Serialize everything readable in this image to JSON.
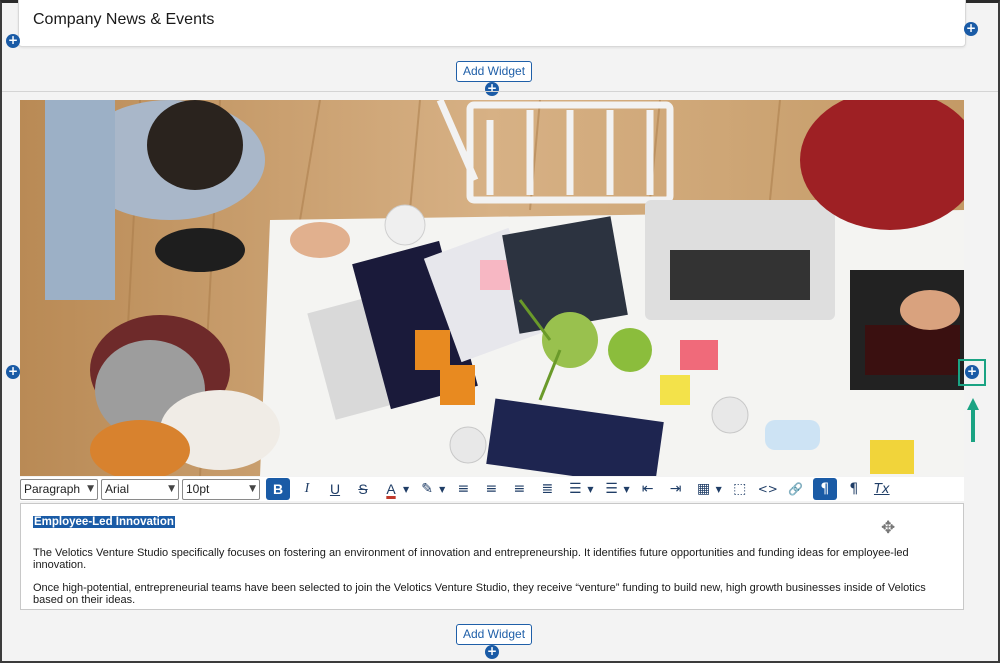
{
  "page": {
    "news_title": "Company News & Events",
    "add_widget_label": "Add Widget",
    "plus_glyph": "+"
  },
  "toolbar": {
    "block_format": "Paragraph",
    "font_family": "Arial",
    "font_size": "10pt",
    "buttons": [
      {
        "name": "bold-button",
        "glyph": "B",
        "active": true
      },
      {
        "name": "italic-button",
        "glyph": "I"
      },
      {
        "name": "underline-button",
        "glyph": "U"
      },
      {
        "name": "strikethrough-button",
        "glyph": "S"
      },
      {
        "name": "text-color-button",
        "glyph": "A"
      },
      {
        "name": "highlight-color-button",
        "glyph": "✎"
      },
      {
        "name": "align-left-button",
        "glyph": "≡"
      },
      {
        "name": "align-center-button",
        "glyph": "≡"
      },
      {
        "name": "align-right-button",
        "glyph": "≡"
      },
      {
        "name": "align-justify-button",
        "glyph": "≣"
      },
      {
        "name": "bullet-list-button",
        "glyph": "☰"
      },
      {
        "name": "numbered-list-button",
        "glyph": "☰"
      },
      {
        "name": "outdent-button",
        "glyph": "⇤"
      },
      {
        "name": "indent-button",
        "glyph": "⇥"
      },
      {
        "name": "table-button",
        "glyph": "▦"
      },
      {
        "name": "select-all-button",
        "glyph": "⬚"
      },
      {
        "name": "source-code-button",
        "glyph": "<>"
      },
      {
        "name": "link-button",
        "glyph": "🔗"
      },
      {
        "name": "ltr-button",
        "glyph": "¶"
      },
      {
        "name": "rtl-button",
        "glyph": "¶"
      },
      {
        "name": "clear-format-button",
        "glyph": "Tx"
      }
    ]
  },
  "editor": {
    "heading": "Employee-Led Innovation",
    "paragraph_1": "The Velotics Venture Studio specifically focuses on fostering an environment of innovation and entrepreneurship. It identifies future opportunities and funding ideas for employee-led innovation.",
    "paragraph_2": "Once high-potential, entrepreneurial teams have been selected to join the Velotics Venture Studio, they receive “venture” funding to build new, high growth businesses inside of Velotics based on their ideas."
  },
  "colors": {
    "accent_blue": "#1a5ba6",
    "highlight_green": "#1aa383"
  }
}
